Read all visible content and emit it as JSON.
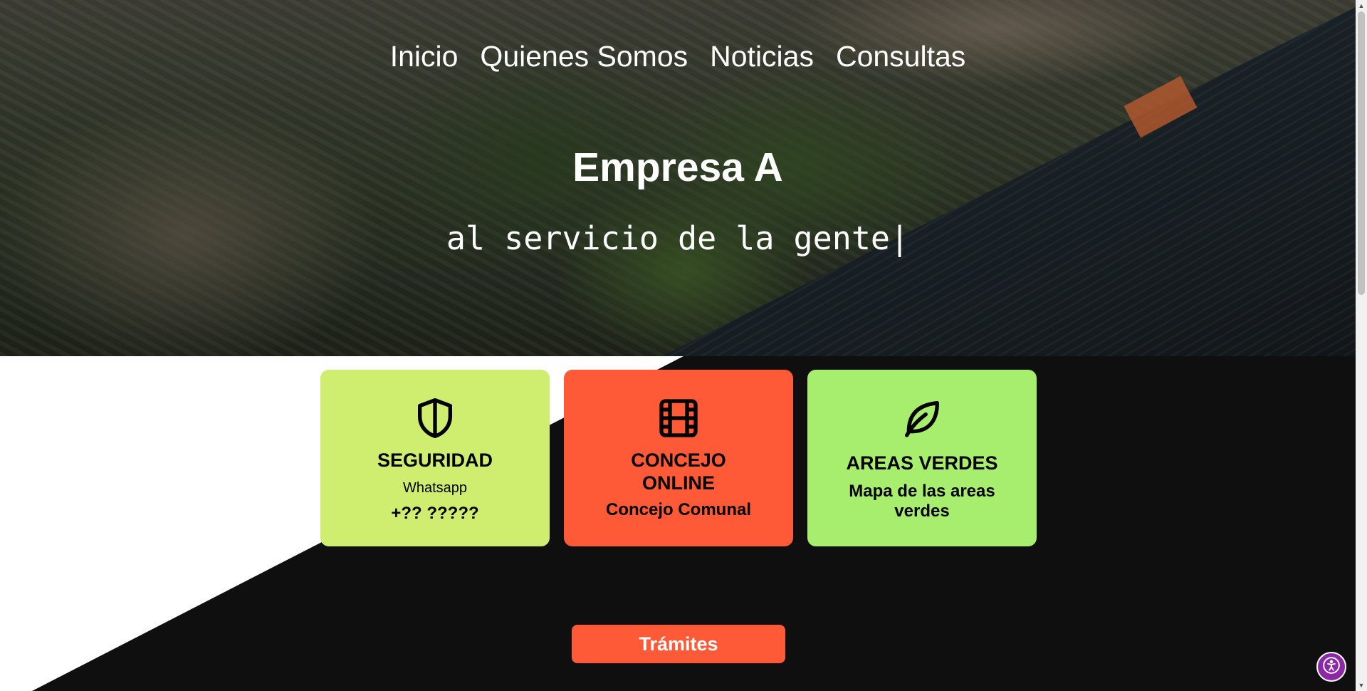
{
  "nav": {
    "items": [
      {
        "label": "Inicio"
      },
      {
        "label": "Quienes Somos"
      },
      {
        "label": "Noticias"
      },
      {
        "label": "Consultas"
      }
    ]
  },
  "hero": {
    "title": "Empresa A",
    "tagline": "al servicio de la gente|"
  },
  "cards": [
    {
      "icon": "shield-icon",
      "title": "SEGURIDAD",
      "subtitle": "Whatsapp",
      "info": "+?? ?????",
      "color": "#cfee70"
    },
    {
      "icon": "film-icon",
      "title": "CONCEJO ONLINE",
      "info": "Concejo Comunal",
      "color": "#ff5a38"
    },
    {
      "icon": "leaf-icon",
      "title": "AREAS VERDES",
      "info": "Mapa de las areas verdes",
      "color": "#a8ee6e"
    }
  ],
  "tramites_button": {
    "label": "Trámites",
    "color": "#ff5a38"
  },
  "accessibility_button": {
    "icon": "accessibility-icon",
    "color": "#8c27a6"
  }
}
